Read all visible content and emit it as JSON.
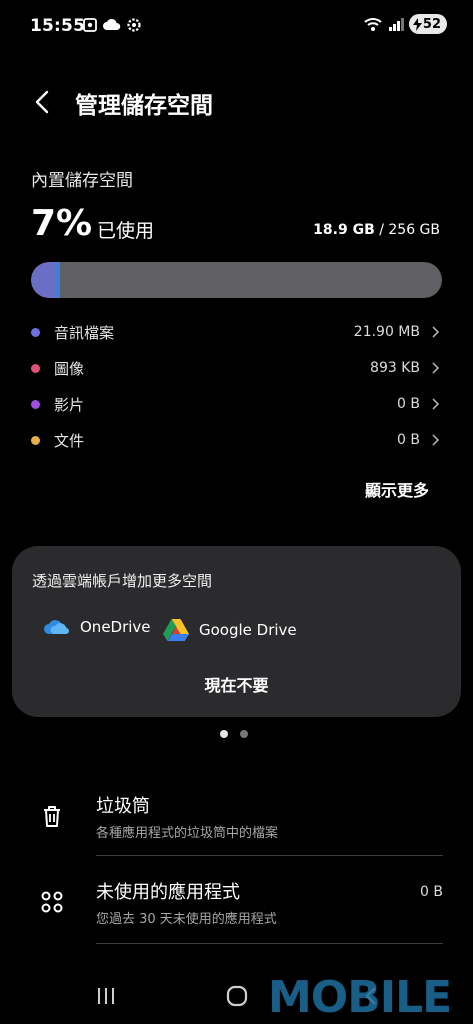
{
  "status_bar": {
    "time": "15:55",
    "battery": "52"
  },
  "header": {
    "title": "管理儲存空間"
  },
  "storage": {
    "section_label": "內置儲存空間",
    "percent": "7%",
    "used_label": "已使用",
    "used_amount": "18.9 GB",
    "separator": " / ",
    "total_amount": "256 GB",
    "used_fraction": 0.07,
    "accent_color": "#6a6ec4"
  },
  "categories": [
    {
      "name": "音訊檔案",
      "value": "21.90 MB",
      "color": "#6d72e0"
    },
    {
      "name": "圖像",
      "value": "893 KB",
      "color": "#e0527a"
    },
    {
      "name": "影片",
      "value": "0 B",
      "color": "#9b4fe3"
    },
    {
      "name": "文件",
      "value": "0 B",
      "color": "#e8b04a"
    }
  ],
  "show_more": "顯示更多",
  "cloud_card": {
    "title": "透過雲端帳戶增加更多空間",
    "services": [
      {
        "name": "OneDrive",
        "icon": "onedrive-icon"
      },
      {
        "name": "Google Drive",
        "icon": "google-drive-icon"
      }
    ],
    "dismiss": "現在不要"
  },
  "pager": {
    "count": 2,
    "active": 0
  },
  "items": [
    {
      "title": "垃圾筒",
      "subtitle": "各種應用程式的垃圾筒中的檔案",
      "value": "",
      "icon": "trash-icon"
    },
    {
      "title": "未使用的應用程式",
      "subtitle": "您過去 30 天未使用的應用程式",
      "value": "0 B",
      "icon": "apps-grid-icon"
    }
  ],
  "watermark": "MOBILE"
}
